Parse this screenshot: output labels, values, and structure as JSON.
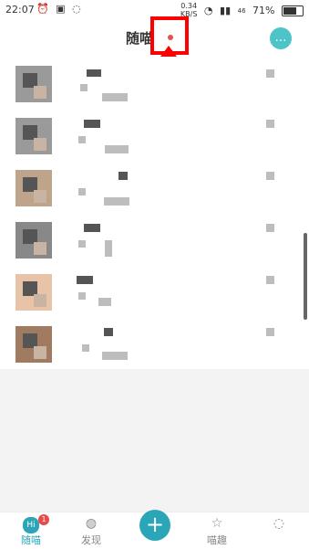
{
  "status_bar": {
    "time": "22:07",
    "net_speed_value": "0.34",
    "net_speed_unit": "KB/S",
    "signal_label": "46",
    "battery": "71%"
  },
  "header": {
    "title": "随喵"
  },
  "list": {
    "items": [
      {
        "avatar": "avatar-1"
      },
      {
        "avatar": "avatar-2"
      },
      {
        "avatar": "avatar-3"
      },
      {
        "avatar": "avatar-4"
      },
      {
        "avatar": "avatar-5"
      },
      {
        "avatar": "avatar-6"
      }
    ]
  },
  "tabbar": {
    "tabs": [
      {
        "label": "随喵",
        "badge": "1",
        "icon": "hi-chat-icon",
        "hi_text": "Hi",
        "active": true
      },
      {
        "label": "发现",
        "icon": "planet-icon",
        "active": false
      },
      {
        "label": "+",
        "icon": "plus-icon",
        "active": false
      },
      {
        "label": "喵趣",
        "icon": "star-icon",
        "active": false
      },
      {
        "label": "",
        "icon": "profile-icon",
        "active": false
      }
    ]
  },
  "colors": {
    "accent": "#2aa6b8",
    "badge": "#e84a4a",
    "annotation": "#ff0000"
  }
}
